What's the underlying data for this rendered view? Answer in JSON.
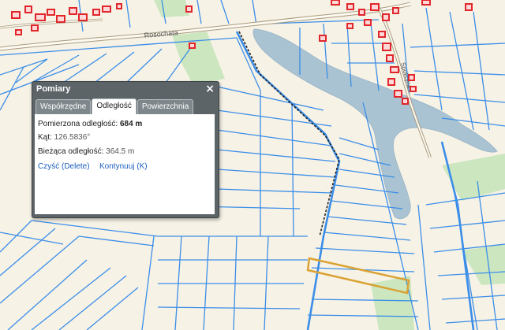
{
  "map": {
    "road_label": "Rosochata",
    "street_label": "Spokojna"
  },
  "panel": {
    "title": "Pomiary",
    "close_symbol": "×",
    "tabs": [
      {
        "label": "Współrzędne",
        "active": false
      },
      {
        "label": "Odległość",
        "active": true
      },
      {
        "label": "Powierzchnia",
        "active": false
      }
    ],
    "measured_label": "Pomierzona odległość:",
    "measured_value": "684 m",
    "angle_label": "Kąt:",
    "angle_value": "126.5836°",
    "current_label": "Bieżąca odległość:",
    "current_value": "364.5 m",
    "clear_link": "Czyść (Delete)",
    "continue_link": "Kontynuuj (K)"
  },
  "colors": {
    "parcel_lines": "#3b8ee8",
    "water": "#a9c3d2",
    "buildings": "#e0262b",
    "road": "#a89a7e",
    "meadow": "#cce7c0",
    "highlight_parcel": "#d9a233",
    "measure_line": "#222222"
  },
  "icons": [
    "close-icon"
  ]
}
